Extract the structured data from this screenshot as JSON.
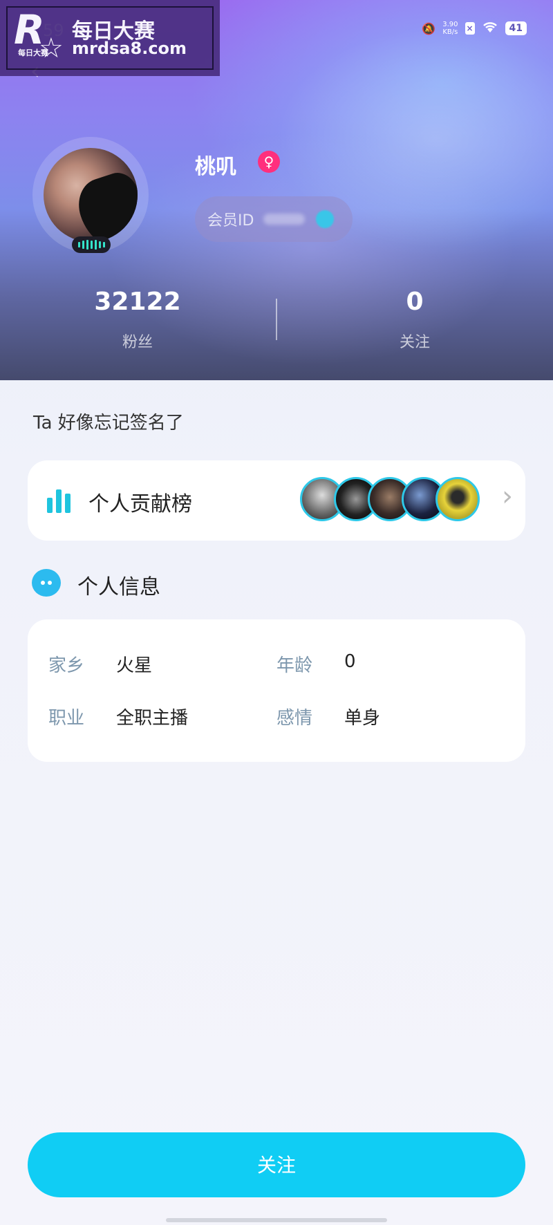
{
  "watermark": {
    "brand_title": "每日大赛",
    "url": "mrdsa8.com",
    "logo_small": "每日大赛",
    "logo_letter": "R"
  },
  "status_bar": {
    "time": "59",
    "net_speed_top": "3.90",
    "net_speed_unit": "KB/s",
    "battery": "41"
  },
  "profile": {
    "name": "桃叽",
    "gender_icon": "female-icon",
    "member_id_label": "会员ID",
    "stats": {
      "fans_value": "32122",
      "fans_label": "粉丝",
      "follow_value": "0",
      "follow_label": "关注"
    },
    "signature": "Ta 好像忘记签名了"
  },
  "contribution": {
    "title": "个人贡献榜"
  },
  "info_section": {
    "title": "个人信息",
    "hometown_label": "家乡",
    "hometown_value": "火星",
    "age_label": "年龄",
    "age_value": "0",
    "job_label": "职业",
    "job_value": "全职主播",
    "relationship_label": "感情",
    "relationship_value": "单身"
  },
  "actions": {
    "follow_label": "关注"
  },
  "colors": {
    "accent": "#10cdf4",
    "gender_badge": "#ff2f7d",
    "label_gray": "#7d97ad"
  }
}
